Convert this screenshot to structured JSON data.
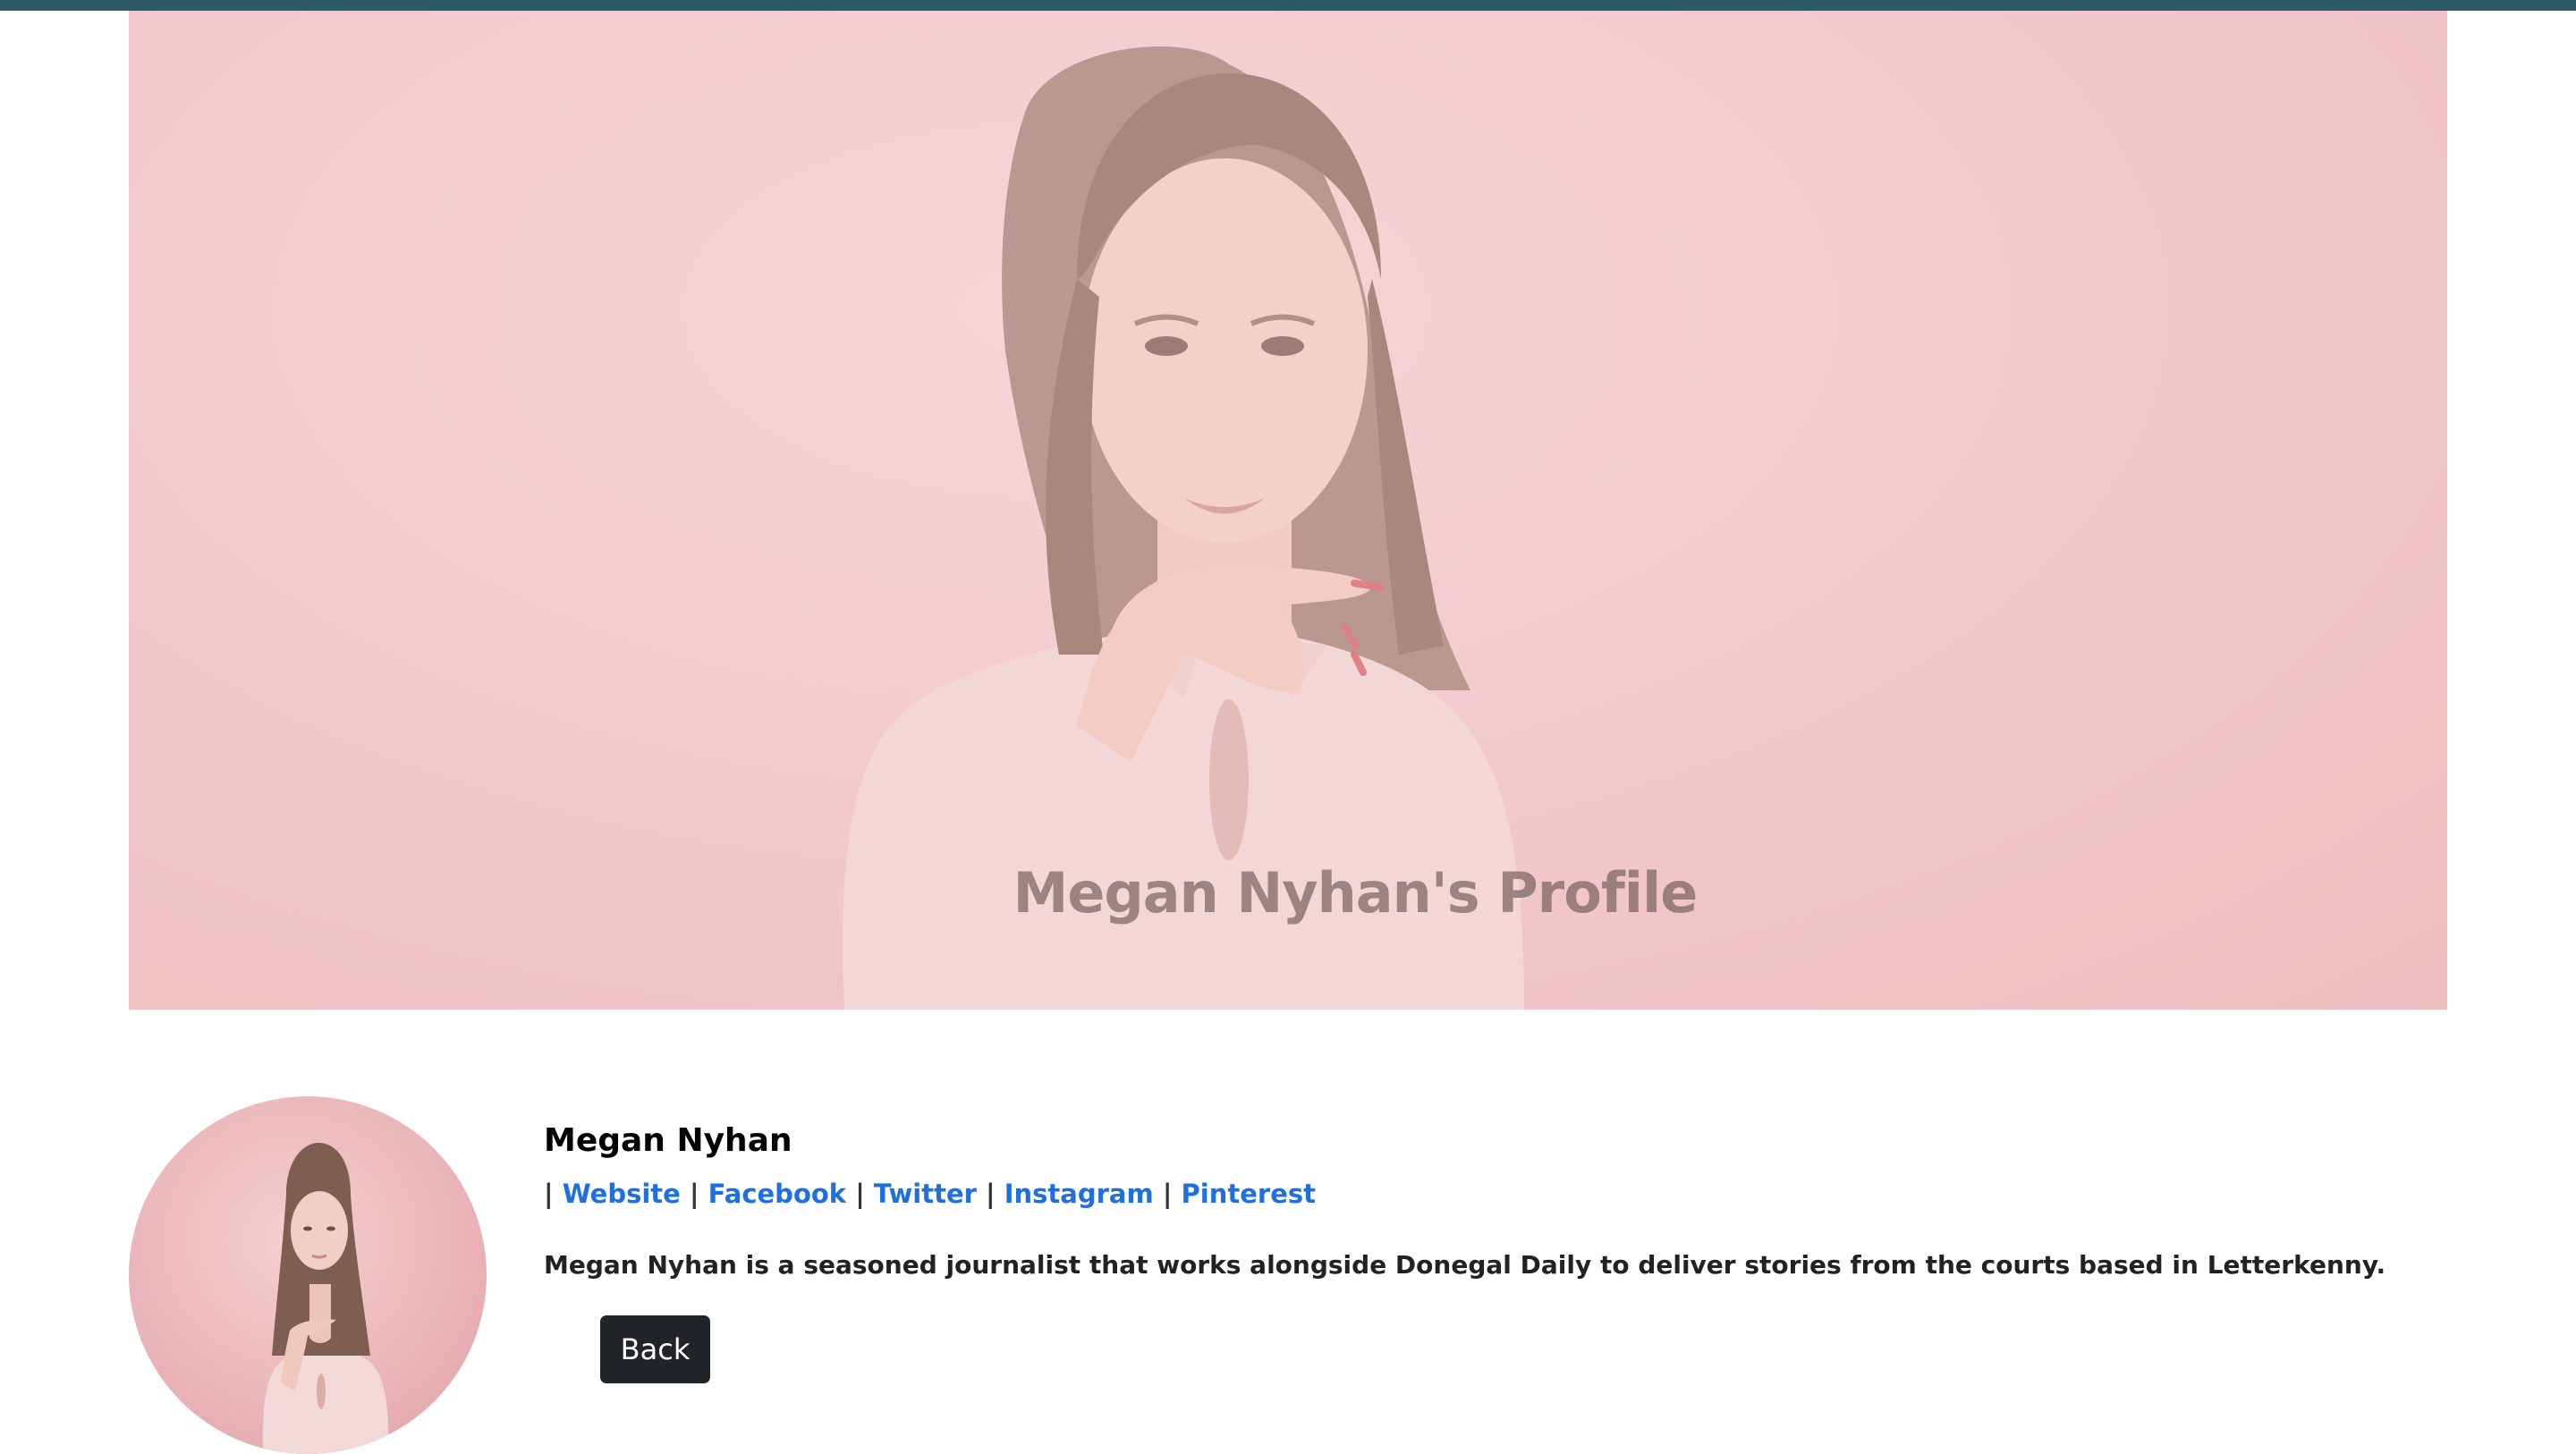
{
  "hero": {
    "title": "Megan Nyhan's Profile"
  },
  "profile": {
    "name": "Megan Nyhan",
    "links": [
      {
        "label": "Website"
      },
      {
        "label": "Facebook"
      },
      {
        "label": "Twitter"
      },
      {
        "label": "Instagram"
      },
      {
        "label": "Pinterest"
      }
    ],
    "separator": "|",
    "bio": "Megan Nyhan is a seasoned journalist that works alongside Donegal Daily to deliver stories from the courts based in Letterkenny.",
    "back_label": "Back"
  },
  "colors": {
    "top_bar": "#2a5b66",
    "hero_background": "#f1c7c9",
    "link": "#1f6fe0",
    "button_background": "#212529"
  },
  "icons": {
    "hero_image": "woman-portrait-image",
    "avatar_image": "woman-portrait-image"
  }
}
